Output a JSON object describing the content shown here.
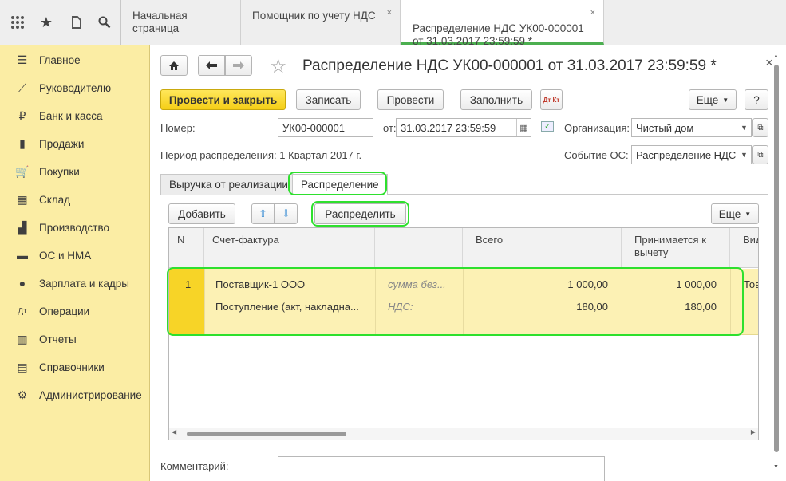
{
  "tabs": [
    {
      "label": "Начальная страница"
    },
    {
      "label": "Помощник по учету НДС"
    },
    {
      "label": "Распределение НДС УК00-000001\nот 31.03.2017 23:59:59 *"
    }
  ],
  "tab_close": "×",
  "sidebar": {
    "items": [
      {
        "label": "Главное",
        "icon": "☰"
      },
      {
        "label": "Руководителю",
        "icon": "⟋"
      },
      {
        "label": "Банк и касса",
        "icon": "₽"
      },
      {
        "label": "Продажи",
        "icon": "▮"
      },
      {
        "label": "Покупки",
        "icon": "🛒"
      },
      {
        "label": "Склад",
        "icon": "▦"
      },
      {
        "label": "Производство",
        "icon": "▟"
      },
      {
        "label": "ОС и НМА",
        "icon": "▬"
      },
      {
        "label": "Зарплата и кадры",
        "icon": "●"
      },
      {
        "label": "Операции",
        "icon": "Дт"
      },
      {
        "label": "Отчеты",
        "icon": "▥"
      },
      {
        "label": "Справочники",
        "icon": "▤"
      },
      {
        "label": "Администрирование",
        "icon": "⚙"
      }
    ]
  },
  "doc": {
    "title": "Распределение НДС УК00-000001 от 31.03.2017 23:59:59 *",
    "close": "×",
    "buttons": {
      "post_close": "Провести и закрыть",
      "save": "Записать",
      "post": "Провести",
      "fill": "Заполнить",
      "dt_kt": "Дт Кт",
      "more": "Еще",
      "help": "?"
    },
    "fields": {
      "number_label": "Номер:",
      "number_value": "УК00-000001",
      "date_label": "от:",
      "date_value": "31.03.2017 23:59:59",
      "org_label": "Организация:",
      "org_value": "Чистый дом",
      "period_label": "Период распределения: 1 Квартал 2017  г.",
      "event_label": "Событие ОС:",
      "event_value": "Распределение НДС"
    },
    "subtabs": [
      "Выручка от реализации",
      "Распределение"
    ],
    "table_toolbar": {
      "add": "Добавить",
      "distribute": "Распределить",
      "more": "Еще"
    },
    "table": {
      "headers": [
        "N",
        "Счет-фактура",
        "",
        "Всего",
        "Принимается к вычету",
        "Вид"
      ],
      "header_display": [
        "N",
        "Счет-фактура",
        "",
        "Всего",
        "Принимается к\nвычету",
        "Вид"
      ],
      "row": {
        "n": "1",
        "invoice1": "Поставщик-1 ООО",
        "invoice2": "Поступление (акт, накладна...",
        "kind1": "сумма без...",
        "kind2": "НДС:",
        "total1": "1 000,00",
        "total2": "180,00",
        "deduct1": "1 000,00",
        "deduct2": "180,00",
        "type1": "Тов"
      }
    },
    "comment_label": "Комментарий:"
  }
}
